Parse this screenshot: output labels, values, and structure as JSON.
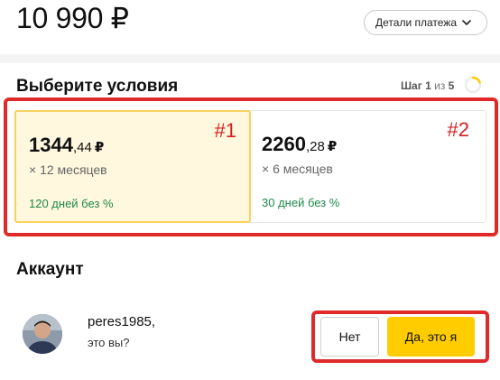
{
  "header": {
    "amount": "10 990 ₽",
    "details_label": "Детали платежа"
  },
  "terms": {
    "title": "Выберите условия",
    "step_label": "Шаг",
    "step_current": "1",
    "step_of": "из",
    "step_total": "5",
    "plans": [
      {
        "tag": "#1",
        "price_int": "1344",
        "price_frac": ",44",
        "currency": "₽",
        "months": "× 12 месяцев",
        "free_text": "120 дней без %",
        "selected": true
      },
      {
        "tag": "#2",
        "price_int": "2260",
        "price_frac": ",28",
        "currency": "₽",
        "months": "× 6 месяцев",
        "free_text": "30 дней без %",
        "selected": false
      }
    ]
  },
  "account": {
    "title": "Аккаунт",
    "username": "peres1985,",
    "question": "это вы?",
    "no_label": "Нет",
    "yes_label": "Да, это я"
  },
  "colors": {
    "accent_yellow": "#ffcc00",
    "selected_bg": "#fff7de",
    "green_text": "#1d8a4a",
    "annotation_red": "#e02a2a"
  },
  "icons": {
    "details_chevron": "chevron-down-icon",
    "step_progress": "progress-ring-icon",
    "avatar": "user-avatar-icon"
  }
}
